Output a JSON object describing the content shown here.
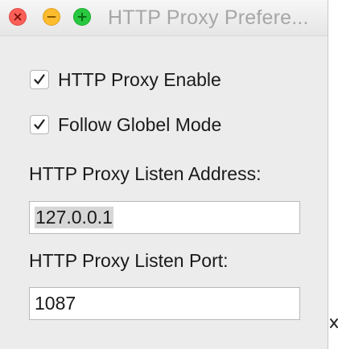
{
  "window": {
    "title": "HTTP Proxy Prefere..."
  },
  "icons": {
    "close": "close-icon",
    "minimize": "minimize-icon",
    "maximize": "maximize-icon",
    "checkmark": "checkmark-icon"
  },
  "colors": {
    "close": "#fc5f57",
    "minimize": "#fdbc2e",
    "maximize": "#28c840",
    "selection": "#d6d6d6"
  },
  "options": {
    "http_proxy_enable": {
      "label": "HTTP Proxy Enable",
      "checked": true
    },
    "follow_global_mode": {
      "label": "Follow Globel Mode",
      "checked": true
    }
  },
  "fields": {
    "listen_address": {
      "label": "HTTP Proxy Listen Address:",
      "value": "127.0.0.1"
    },
    "listen_port": {
      "label": "HTTP Proxy Listen Port:",
      "value": "1087"
    }
  }
}
